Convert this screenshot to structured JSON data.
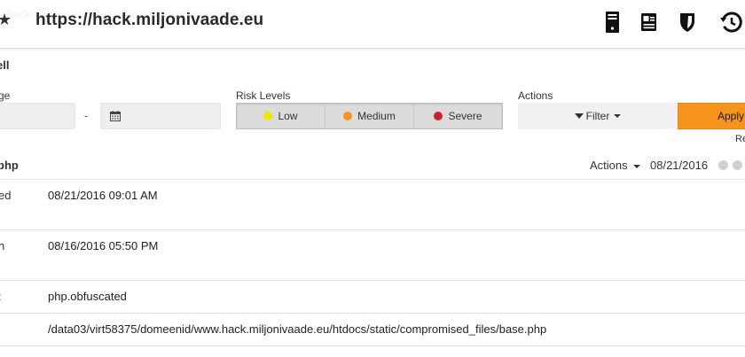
{
  "header": {
    "site_title": "https://hack.miljonivaade.eu",
    "ghost_text": "hack.miljonivaade.eu/htdocs/static/compromised_files"
  },
  "section": {
    "title": "ell"
  },
  "filters": {
    "date_range_label": "ge",
    "date_separator": "-",
    "risk_levels_label": "Risk Levels",
    "risk_levels": [
      {
        "label": "Low",
        "color": "#f2e600"
      },
      {
        "label": "Medium",
        "color": "#f7941d"
      },
      {
        "label": "Severe",
        "color": "#c4262e"
      }
    ],
    "actions_label": "Actions",
    "filter_button": "Filter",
    "apply_button": "Apply",
    "reset_link": "Re"
  },
  "details": {
    "title": "php",
    "actions_label": "Actions",
    "date": "08/21/2016",
    "rows": [
      {
        "label": "ed",
        "value": "08/21/2016 09:01 AM"
      },
      {
        "label": "n",
        "value": "08/16/2016 05:50 PM"
      },
      {
        "label": ":",
        "value": "php.obfuscated"
      },
      {
        "label": "",
        "value": "/data03/virt58375/domeenid/www.hack.miljonivaade.eu/htdocs/static/compromised_files/base.php"
      }
    ]
  },
  "colors": {
    "accent": "#f7941d",
    "low": "#f2e600",
    "medium": "#f7941d",
    "severe": "#c4262e"
  },
  "icons": {
    "favorite": "star-icon",
    "server": "server-icon",
    "id_card": "id-card-icon",
    "shield": "shield-icon",
    "history": "history-icon",
    "calendar": "calendar-icon",
    "filter": "filter-icon"
  }
}
